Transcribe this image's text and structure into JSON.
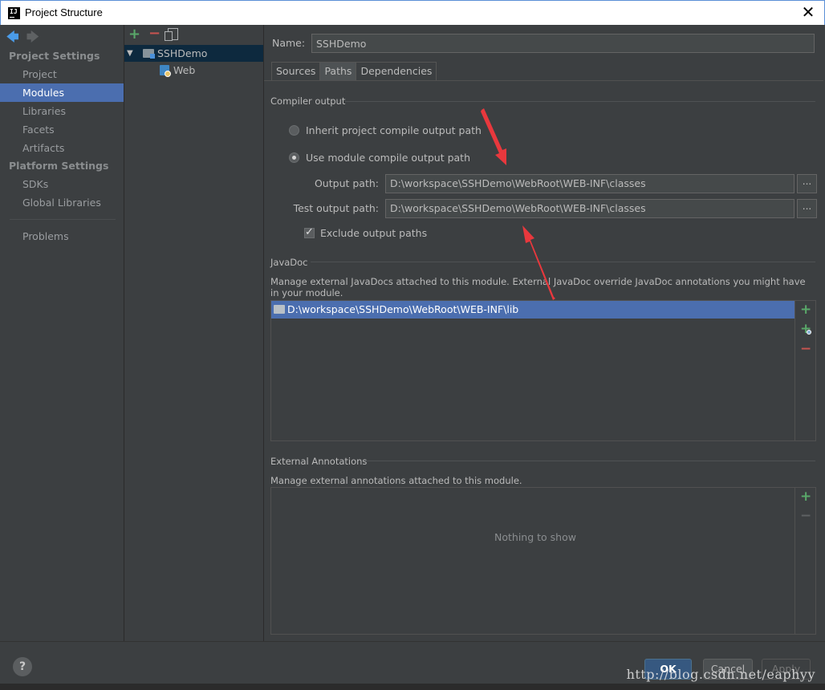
{
  "window": {
    "title": "Project Structure",
    "close_glyph": "✕"
  },
  "nav": {
    "project_settings_header": "Project Settings",
    "project_settings_items": [
      "Project",
      "Modules",
      "Libraries",
      "Facets",
      "Artifacts"
    ],
    "selected": "Modules",
    "platform_settings_header": "Platform Settings",
    "platform_settings_items": [
      "SDKs",
      "Global Libraries"
    ],
    "problems": "Problems"
  },
  "tree": {
    "root": "SSHDemo",
    "child": "Web"
  },
  "module": {
    "name_label": "Name:",
    "name_value": "SSHDemo",
    "tabs": [
      "Sources",
      "Paths",
      "Dependencies"
    ],
    "active_tab": "Paths"
  },
  "compiler_output": {
    "title": "Compiler output",
    "inherit_label": "Inherit project compile output path",
    "use_module_label": "Use module compile output path",
    "selected_option": "use_module",
    "output_path_label": "Output path:",
    "output_path_value": "D:\\workspace\\SSHDemo\\WebRoot\\WEB-INF\\classes",
    "test_output_path_label": "Test output path:",
    "test_output_path_value": "D:\\workspace\\SSHDemo\\WebRoot\\WEB-INF\\classes",
    "browse_label": "...",
    "exclude_label": "Exclude output paths",
    "exclude_checked": true
  },
  "javadoc": {
    "title": "JavaDoc",
    "description": "Manage external JavaDocs attached to this module. External JavaDoc override JavaDoc annotations you might have in your module.",
    "items": [
      "D:\\workspace\\SSHDemo\\WebRoot\\WEB-INF\\lib"
    ]
  },
  "external_annotations": {
    "title": "External Annotations",
    "description": "Manage external annotations attached to this module.",
    "empty_text": "Nothing to show"
  },
  "buttons": {
    "help": "?",
    "ok": "OK",
    "cancel": "Cancel",
    "apply": "Apply"
  },
  "watermark": "http://blog.csdn.net/eaphyy",
  "colors": {
    "accent": "#4b6eaf",
    "arrow": "#e8383d",
    "add": "#59a869",
    "remove": "#c75450"
  }
}
